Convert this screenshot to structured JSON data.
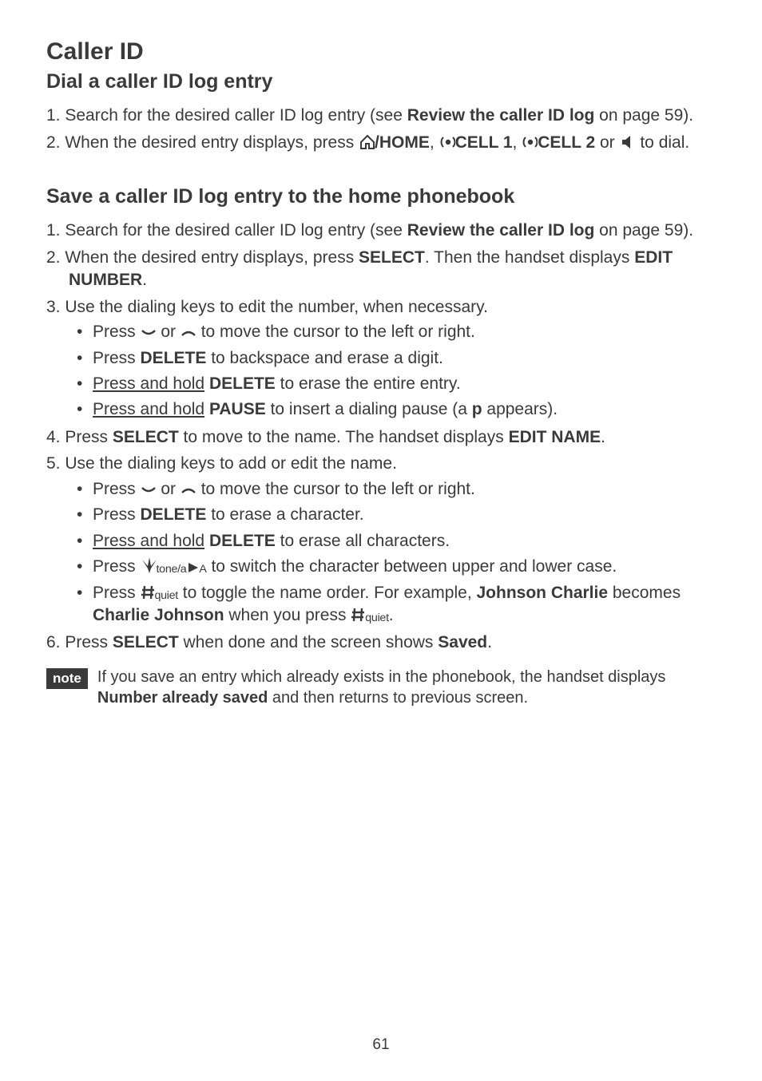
{
  "title": "Caller ID",
  "section1": {
    "heading": "Dial a caller ID log entry",
    "item1": {
      "num": "1.",
      "p1": "Search for the desired caller ID log entry (see ",
      "b1": "Review the caller ID log",
      "p2": " on page 59)."
    },
    "item2": {
      "num": "2.",
      "p1": "When the desired entry displays, press ",
      "b1": "/HOME",
      "comma1": ", ",
      "b2": "CELL 1",
      "comma2": ", ",
      "b3": "CELL 2",
      "p2": " or ",
      "p3": " to dial."
    }
  },
  "section2": {
    "heading": "Save a caller ID log entry to the home phonebook",
    "item1": {
      "num": "1.",
      "p1": "Search for the desired caller ID log entry (see ",
      "b1": "Review the caller ID log",
      "p2": " on page 59)."
    },
    "item2": {
      "num": "2.",
      "p1": "When the desired entry displays, press ",
      "b1": "SELECT",
      "p2": ". Then the handset displays ",
      "b2": "EDIT NUMBER",
      "p3": "."
    },
    "item3": {
      "num": "3.",
      "p1": "Use the dialing keys to edit the number, when necessary.",
      "sub1": {
        "p1": "Press ",
        "p2": " or ",
        "p3": " to move the cursor to the left or right."
      },
      "sub2": {
        "p1": "Press ",
        "b1": "DELETE",
        "p2": " to backspace and erase a digit."
      },
      "sub3": {
        "u1": "Press and hold",
        "sp": " ",
        "b1": "DELETE",
        "p2": " to erase the entire entry."
      },
      "sub4": {
        "u1": "Press and hold",
        "sp": " ",
        "b1": "PAUSE",
        "p2": " to insert a dialing pause (a ",
        "b2": "p",
        "p3": " appears)."
      }
    },
    "item4": {
      "num": "4.",
      "p1": "Press ",
      "b1": "SELECT",
      "p2": " to move to the name. The handset displays ",
      "b2": "EDIT NAME",
      "p3": "."
    },
    "item5": {
      "num": "5.",
      "p1": "Use the dialing keys to add or edit the name.",
      "sub1": {
        "p1": "Press ",
        "p2": " or ",
        "p3": " to move the cursor to the left or right."
      },
      "sub2": {
        "p1": "Press ",
        "b1": "DELETE",
        "p2": " to erase a character."
      },
      "sub3": {
        "u1": "Press and hold",
        "sp": " ",
        "b1": "DELETE",
        "p2": " to erase all characters."
      },
      "sub4": {
        "p1": "Press ",
        "s1": "tone/a",
        "s2": "A",
        "p2": " to switch the character between upper and lower case."
      },
      "sub5": {
        "p1": "Press ",
        "s1": "quiet",
        "p2": " to toggle the name order. For example, ",
        "b1": "Johnson Charlie",
        "p3": " becomes ",
        "b2": "Charlie Johnson",
        "p4": " when you press ",
        "s2": "quiet",
        "p5": "."
      }
    },
    "item6": {
      "num": "6.",
      "p1": "Press ",
      "b1": "SELECT",
      "p2": " when done and the screen shows ",
      "b2": "Saved",
      "p3": "."
    }
  },
  "note": {
    "badge": "note",
    "p1": "If you save an entry which already exists in the phonebook, the handset displays ",
    "b1": "Number already saved",
    "p2": " and then returns to previous screen."
  },
  "page": "61"
}
